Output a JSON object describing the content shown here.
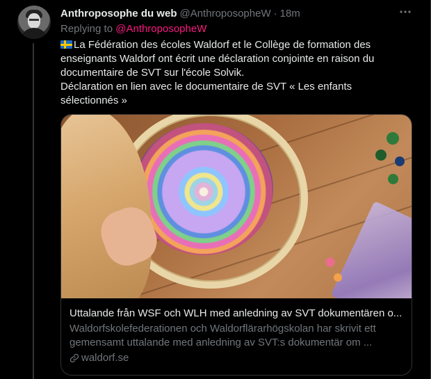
{
  "tweet": {
    "author_name": "Anthroposophe du web",
    "author_handle": "@AnthroposopheW",
    "separator": "·",
    "time": "18m",
    "more_icon": "more-icon",
    "replying_prefix": "Replying to",
    "replying_mention": "@AnthroposopheW",
    "text_line1": "La Fédération des écoles Waldorf et le Collège de formation des enseignants Waldorf ont écrit une déclaration conjointe en raison du documentaire de SVT sur l'école Solvik.",
    "text_line2": "Déclaration en lien avec le documentaire de SVT « Les enfants sélectionnés »",
    "flag_icon": "sweden-flag-icon"
  },
  "card": {
    "image_icon": "card-image",
    "title": "Uttalande från WSF och WLH med anledning av SVT dokumentären o...",
    "description": "Waldorfskolefederationen och Waldorflärarhögskolan har skrivit ett gemensamt uttalande med anledning av SVT:s dokumentär om ...",
    "domain": "waldorf.se",
    "link_icon": "link-icon"
  },
  "colors": {
    "background": "#000000",
    "text": "#e7e9ea",
    "muted": "#71767b",
    "mention": "#f91880",
    "border": "#2f3336"
  }
}
